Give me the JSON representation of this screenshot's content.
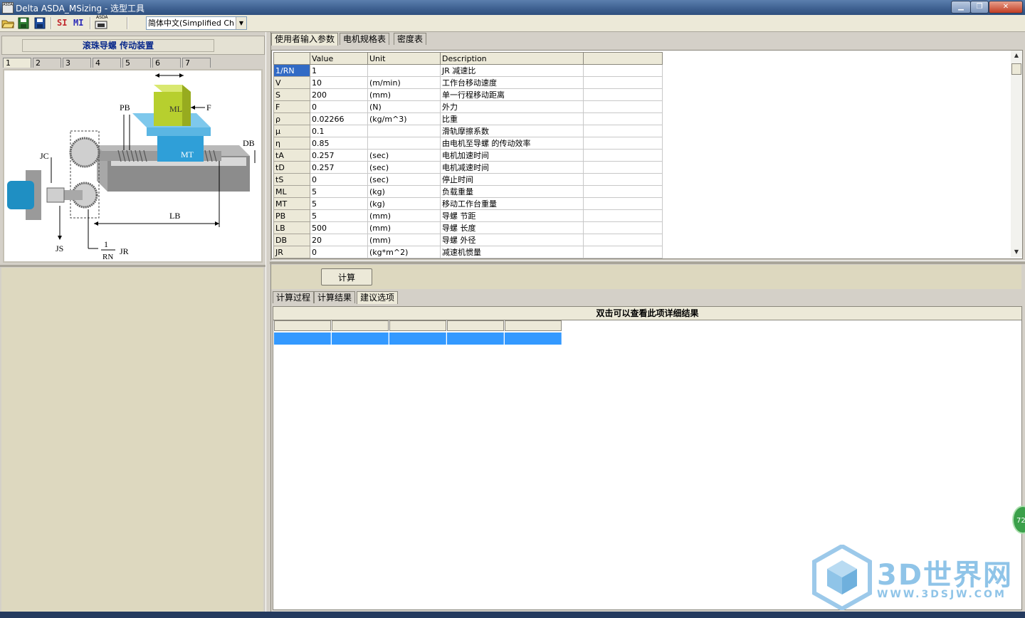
{
  "app": {
    "title": "Delta ASDA_MSizing - 选型工具",
    "icon_text": "ASDA",
    "minimize_symbol": "▁",
    "maximize_symbol": "❐",
    "close_symbol": "✕"
  },
  "toolbar": {
    "si_label": "SI",
    "mi_label": "MI",
    "asda_label": "ASDA",
    "language_value": "简体中文(Simplified Chine",
    "language_arrow": "▼",
    "colors": {
      "si": "#c0282d",
      "mi": "#2b2bb8"
    }
  },
  "left": {
    "header_title": "滚珠导螺 传动装置",
    "tabs": [
      "1",
      "2",
      "3",
      "4",
      "5",
      "6",
      "7"
    ],
    "diagram_labels": {
      "ml": "ML",
      "mt": "MT",
      "f": "F",
      "pb": "PB",
      "db": "DB",
      "jc": "JC",
      "js": "JS",
      "lb": "LB",
      "jr": "JR",
      "rn_num": "1",
      "rn_den": "RN"
    }
  },
  "input_tabs": [
    "使用者输入参数",
    "电机规格表",
    "密度表"
  ],
  "grid": {
    "columns": [
      "Value",
      "Unit",
      "Description",
      ""
    ],
    "rows": [
      {
        "key": "1/RN",
        "value": "1",
        "unit": "",
        "desc": "JR 减速比"
      },
      {
        "key": "V",
        "value": "10",
        "unit": "(m/min)",
        "desc": "工作台移动速度"
      },
      {
        "key": "S",
        "value": "200",
        "unit": "(mm)",
        "desc": "单一行程移动距离"
      },
      {
        "key": "F",
        "value": "0",
        "unit": "(N)",
        "desc": "外力"
      },
      {
        "key": "ρ",
        "value": "0.02266",
        "unit": "(kg/m^3)",
        "desc": "比重"
      },
      {
        "key": "μ",
        "value": "0.1",
        "unit": "",
        "desc": "滑轨摩擦系数"
      },
      {
        "key": "η",
        "value": "0.85",
        "unit": "",
        "desc": "由电机至导螺 的传动效率"
      },
      {
        "key": "tA",
        "value": "0.257",
        "unit": "(sec)",
        "desc": "电机加速时间"
      },
      {
        "key": "tD",
        "value": "0.257",
        "unit": "(sec)",
        "desc": "电机减速时间"
      },
      {
        "key": "tS",
        "value": "0",
        "unit": "(sec)",
        "desc": "停止时间"
      },
      {
        "key": "ML",
        "value": "5",
        "unit": "(kg)",
        "desc": "负载重量"
      },
      {
        "key": "MT",
        "value": "5",
        "unit": "(kg)",
        "desc": "移动工作台重量"
      },
      {
        "key": "PB",
        "value": "5",
        "unit": "(mm)",
        "desc": "导螺 节距"
      },
      {
        "key": "LB",
        "value": "500",
        "unit": "(mm)",
        "desc": "导螺 长度"
      },
      {
        "key": "DB",
        "value": "20",
        "unit": "(mm)",
        "desc": "导螺 外径"
      },
      {
        "key": "JR",
        "value": "0",
        "unit": "(kg*m^2)",
        "desc": "减速机惯量"
      }
    ],
    "scroll_up": "▲",
    "scroll_down": "▼"
  },
  "calc_button": "计算",
  "result_tabs": [
    "计算过程",
    "计算结果",
    "建议选项"
  ],
  "results": {
    "header": "双击可以查看此项详细结果",
    "selected_color": "#3399ff"
  },
  "badge_text": "72",
  "watermark": {
    "main": "3D世界网",
    "sub": "WWW.3DSJW.COM"
  }
}
